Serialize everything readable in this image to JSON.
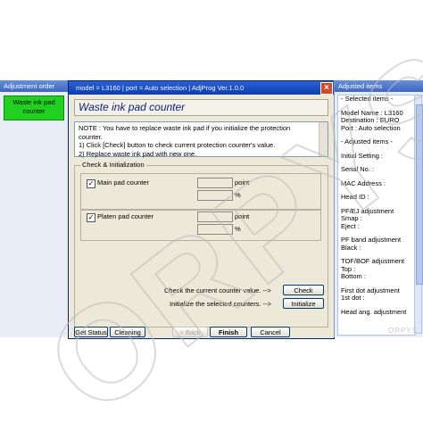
{
  "left_panel": {
    "title": "Adjustment order",
    "active_item": "Waste ink pad counter"
  },
  "window": {
    "title": "model = L3160  |  port = Auto selection  |  AdjProg Ver.1.0.0",
    "close_glyph": "×"
  },
  "heading": "Waste ink pad counter",
  "note": {
    "line1": "NOTE : You have to replace waste ink pad if you initialize the protection",
    "line2": "counter.",
    "line3": "1) Click [Check] button to check current protection counter's value.",
    "line4": "2) Replace waste ink pad with new one."
  },
  "group": {
    "label": "Check & Initialization",
    "main_pad": {
      "label": "Main pad counter",
      "checked": true,
      "unit_point": "point",
      "unit_percent": "%",
      "point_value": "",
      "percent_value": ""
    },
    "platen_pad": {
      "label": "Platen pad counter",
      "checked": true,
      "unit_point": "point",
      "unit_percent": "%",
      "point_value": "",
      "percent_value": ""
    }
  },
  "actions": {
    "check_text": "Check the current counter value. -->",
    "check_button": "Check",
    "init_text": "Initialize the selected counters. -->",
    "init_button": "Initialize"
  },
  "bottom_buttons": {
    "get_status": "Get Status",
    "cleaning": "Cleaning",
    "back": "< Back",
    "finish": "Finish",
    "cancel": "Cancel"
  },
  "right_panel": {
    "title": "Adjusted items",
    "lines": [
      "- Selected items -",
      "Model Name : L3160",
      "Destination : EURO",
      "Port : Auto selection",
      "- Adjusted items -",
      "Initial Setting :",
      "Serial No. :",
      "MAC Address :",
      "Head ID :",
      "PF/EJ adjustment",
      "  Smap :",
      "  Eject :",
      "PF band adjustment",
      "  Black :",
      "TOF/BOF adjustment",
      "  Top :",
      "  Bottom :",
      "First dot adjustment",
      "  1st dot :",
      "Head ang. adjustment"
    ]
  },
  "watermark": {
    "text": "ORPYS",
    "brand": "ORPYS"
  },
  "colors": {
    "accent_green": "#21d11f",
    "title_blue": "#0b3fb0",
    "window_bg": "#ece9d8"
  }
}
